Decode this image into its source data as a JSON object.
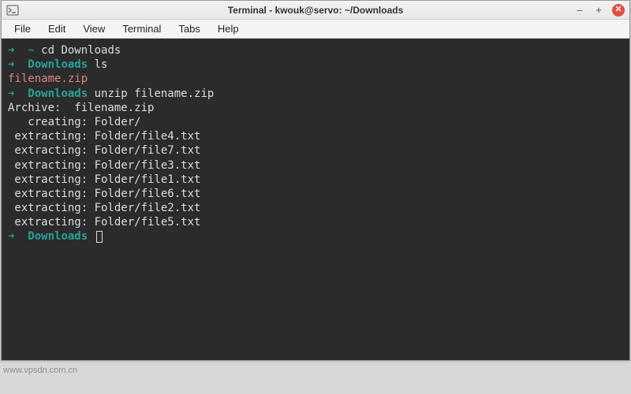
{
  "window": {
    "title": "Terminal - kwouk@servo: ~/Downloads"
  },
  "menubar": {
    "items": [
      "File",
      "Edit",
      "View",
      "Terminal",
      "Tabs",
      "Help"
    ]
  },
  "controls": {
    "minimize": "–",
    "maximize": "+",
    "close": "✕"
  },
  "terminal": {
    "lines": [
      {
        "type": "prompt-home",
        "prompt_arrow": "➜",
        "prompt_loc": "~",
        "cmd": "cd Downloads"
      },
      {
        "type": "prompt-dir",
        "prompt_arrow": "➜",
        "prompt_loc": "Downloads",
        "cmd": "ls"
      },
      {
        "type": "filename",
        "text": "filename.zip"
      },
      {
        "type": "prompt-dir",
        "prompt_arrow": "➜",
        "prompt_loc": "Downloads",
        "cmd": "unzip filename.zip"
      },
      {
        "type": "plain",
        "text": "Archive:  filename.zip"
      },
      {
        "type": "plain",
        "text": "   creating: Folder/"
      },
      {
        "type": "plain",
        "text": " extracting: Folder/file4.txt"
      },
      {
        "type": "plain",
        "text": " extracting: Folder/file7.txt"
      },
      {
        "type": "plain",
        "text": " extracting: Folder/file3.txt"
      },
      {
        "type": "plain",
        "text": " extracting: Folder/file1.txt"
      },
      {
        "type": "plain",
        "text": " extracting: Folder/file6.txt"
      },
      {
        "type": "plain",
        "text": " extracting: Folder/file2.txt"
      },
      {
        "type": "plain",
        "text": " extracting: Folder/file5.txt"
      },
      {
        "type": "prompt-cursor",
        "prompt_arrow": "➜",
        "prompt_loc": "Downloads"
      }
    ]
  },
  "watermark": "www.vpsdn.com.cn"
}
